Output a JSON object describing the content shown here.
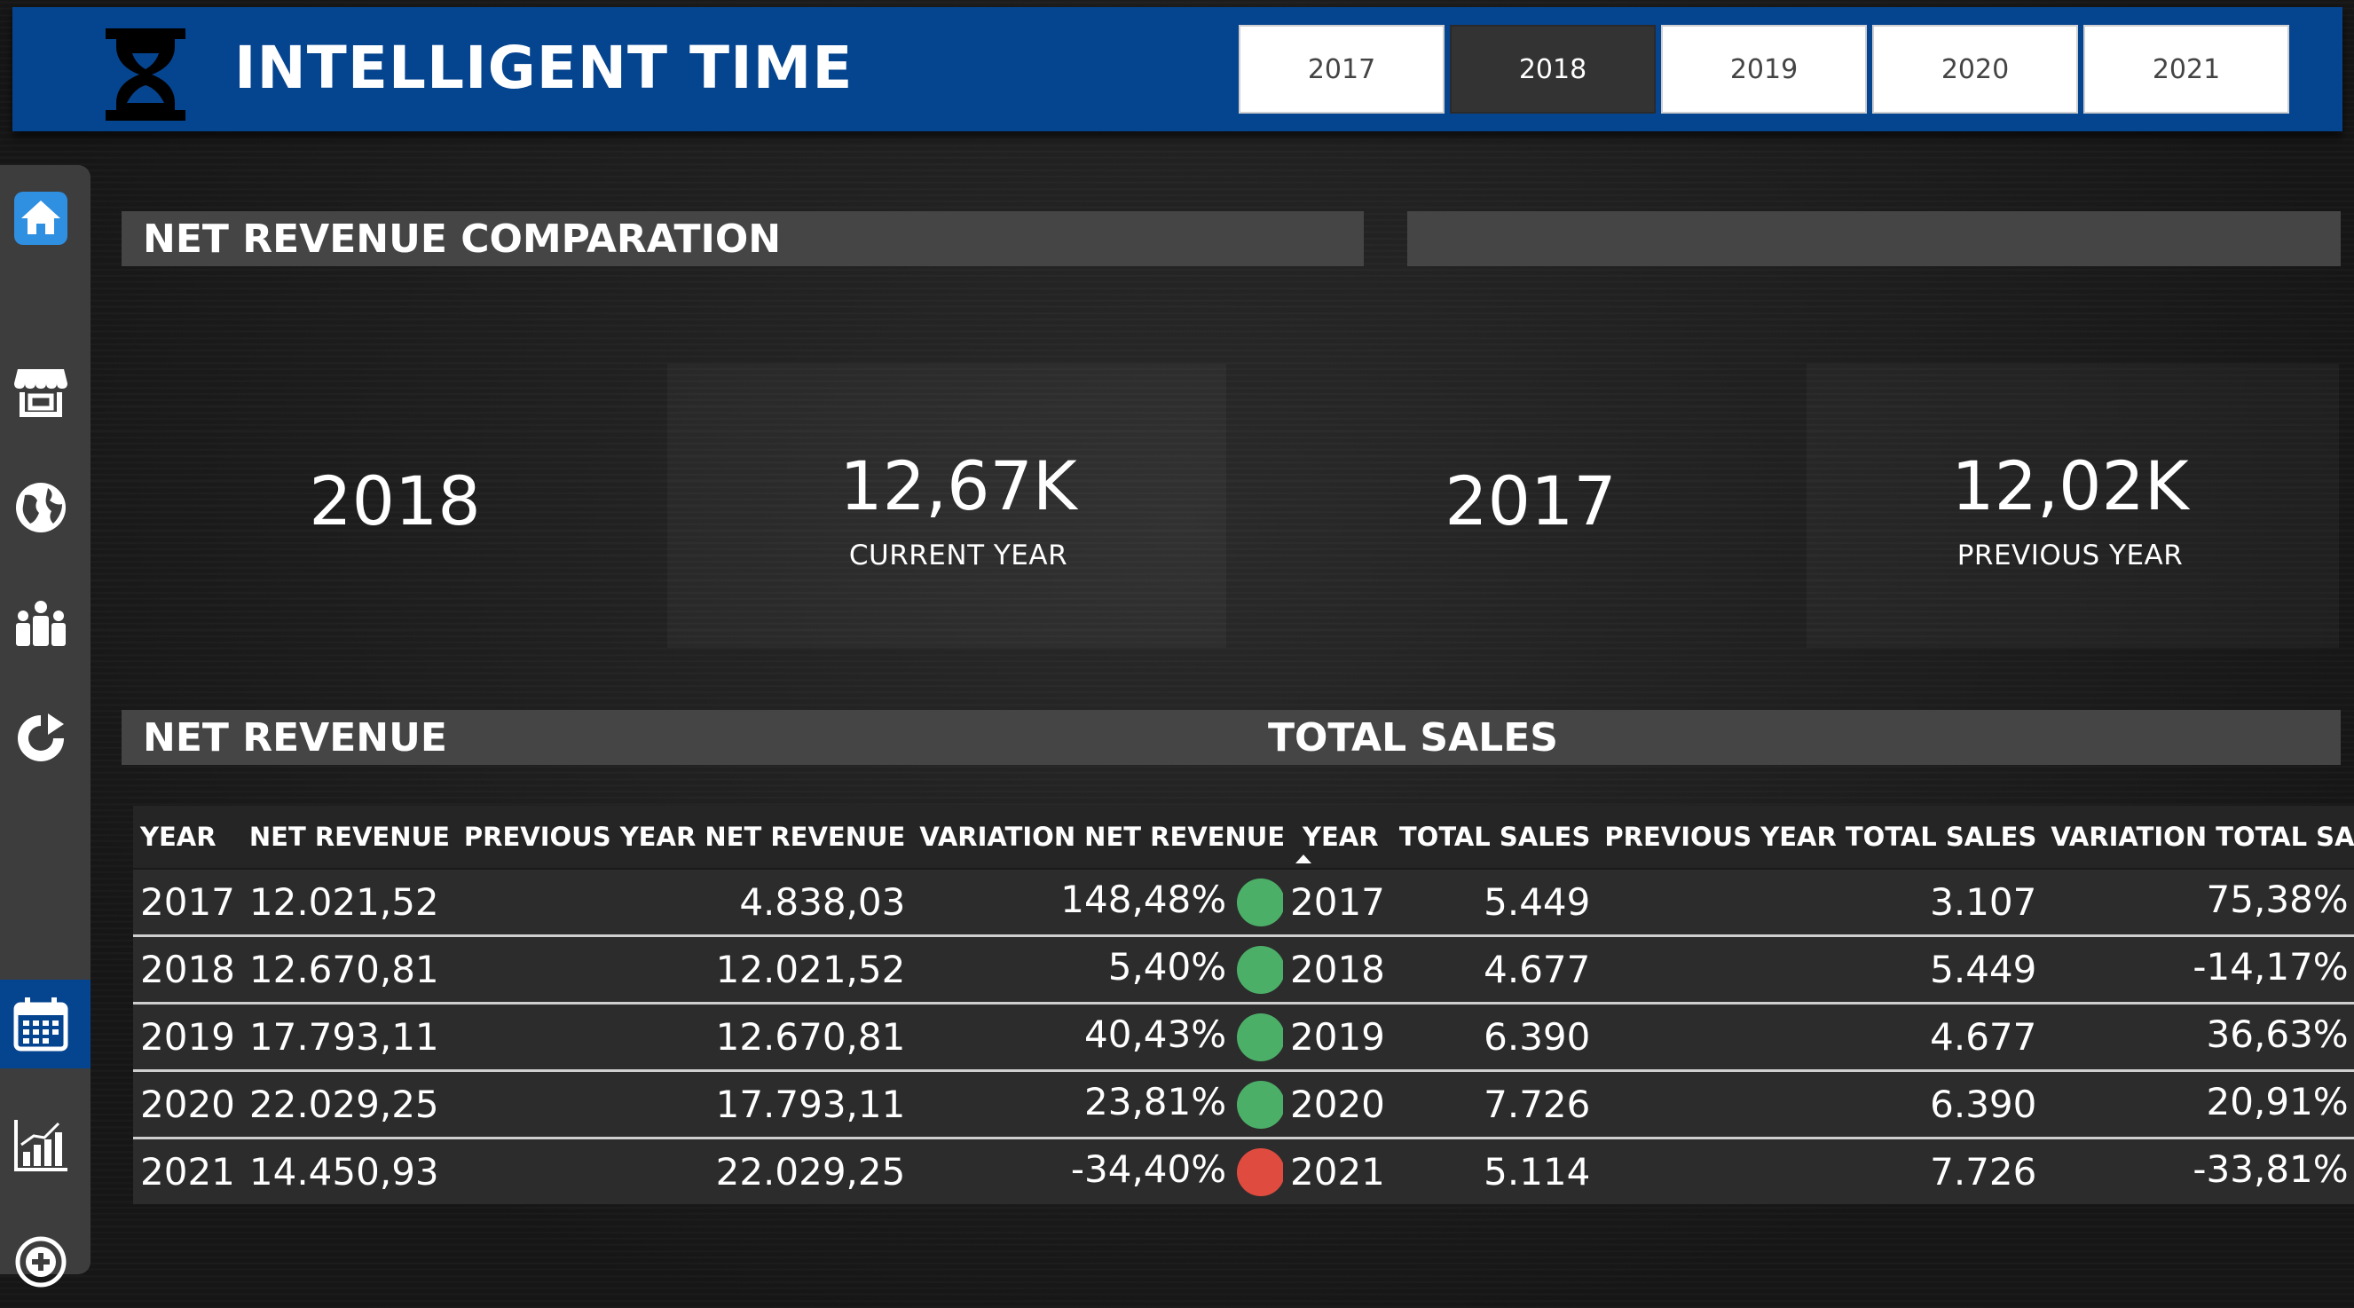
{
  "app": {
    "title": "INTELLIGENT TIME"
  },
  "year_filter": {
    "options": [
      "2017",
      "2018",
      "2019",
      "2020",
      "2021"
    ],
    "selected": "2018"
  },
  "sidebar": {
    "items": [
      "home-icon",
      "store-icon",
      "globe-icon",
      "people-icon",
      "refresh-icon",
      "calendar-icon",
      "bar-chart-icon",
      "add-circle-icon"
    ],
    "active": "calendar-icon"
  },
  "comparison": {
    "title": "NET REVENUE COMPARATION",
    "current_year": "2018",
    "current_value": "12,67K",
    "current_label": "CURRENT YEAR",
    "previous_year": "2017",
    "previous_value": "12,02K",
    "previous_label": "PREVIOUS YEAR"
  },
  "net_revenue": {
    "title": "NET REVENUE",
    "columns": [
      "YEAR",
      "NET REVENUE",
      "PREVIOUS YEAR NET REVENUE",
      "VARIATION NET REVENUE"
    ],
    "rows": [
      {
        "year": "2017",
        "value": "12.021,52",
        "prev": "4.838,03",
        "variation": "148,48%",
        "status": "up"
      },
      {
        "year": "2018",
        "value": "12.670,81",
        "prev": "12.021,52",
        "variation": "5,40%",
        "status": "up"
      },
      {
        "year": "2019",
        "value": "17.793,11",
        "prev": "12.670,81",
        "variation": "40,43%",
        "status": "up"
      },
      {
        "year": "2020",
        "value": "22.029,25",
        "prev": "17.793,11",
        "variation": "23,81%",
        "status": "up"
      },
      {
        "year": "2021",
        "value": "14.450,93",
        "prev": "22.029,25",
        "variation": "-34,40%",
        "status": "down"
      }
    ]
  },
  "total_sales": {
    "title": "TOTAL SALES",
    "columns": [
      "YEAR",
      "TOTAL SALES",
      "PREVIOUS YEAR TOTAL SALES",
      "VARIATION TOTAL SALES"
    ],
    "rows": [
      {
        "year": "2017",
        "value": "5.449",
        "prev": "3.107",
        "variation": "75,38%",
        "status": "up"
      },
      {
        "year": "2018",
        "value": "4.677",
        "prev": "5.449",
        "variation": "-14,17%",
        "status": "down"
      },
      {
        "year": "2019",
        "value": "6.390",
        "prev": "4.677",
        "variation": "36,63%",
        "status": "up"
      },
      {
        "year": "2020",
        "value": "7.726",
        "prev": "6.390",
        "variation": "20,91%",
        "status": "up"
      },
      {
        "year": "2021",
        "value": "5.114",
        "prev": "7.726",
        "variation": "-33,81%",
        "status": "down"
      }
    ]
  },
  "colors": {
    "brand_blue": "#05448f",
    "status_up": "#4caf68",
    "status_down": "#e04b3f"
  }
}
